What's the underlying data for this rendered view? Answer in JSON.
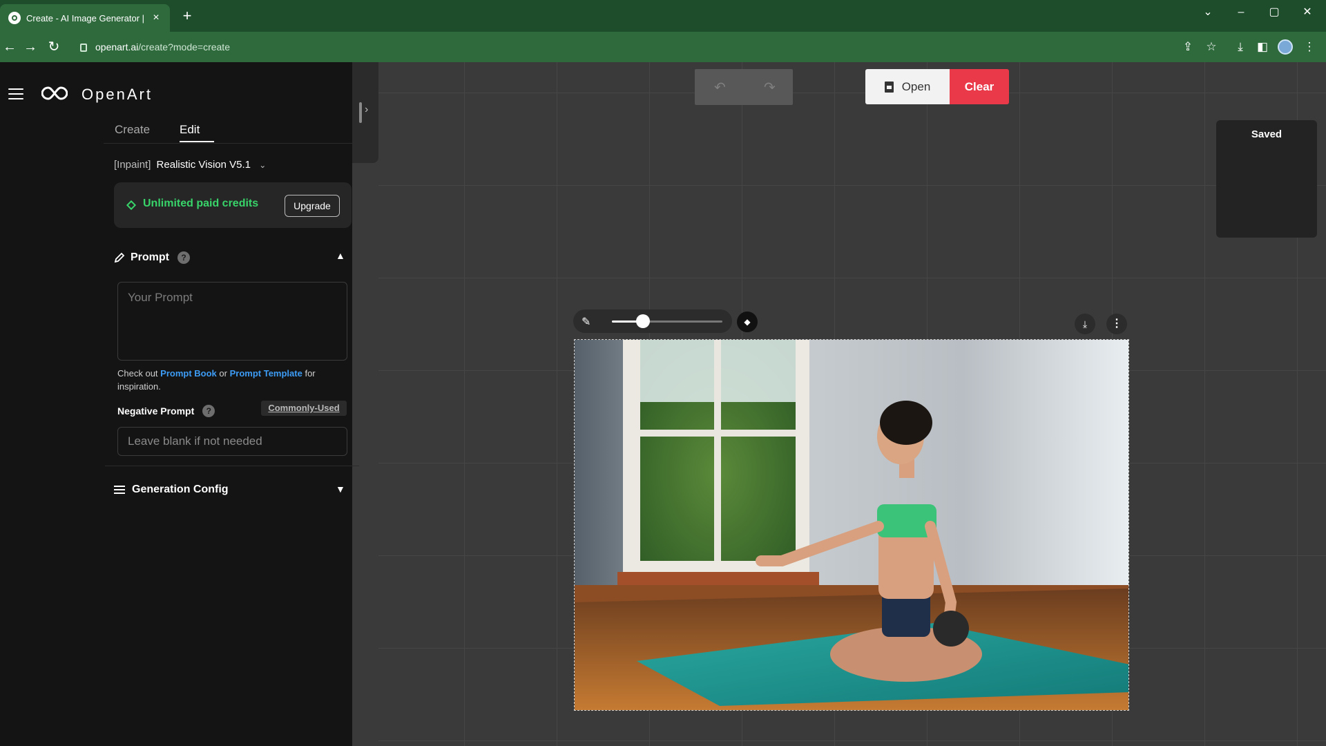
{
  "browser": {
    "tab_title": "Create - AI Image Generator | Op",
    "url_host": "openart.ai",
    "url_path": "/create?mode=create"
  },
  "app": {
    "brand": "OpenArt",
    "tabs": [
      "Create",
      "Edit"
    ],
    "active_tab": "Edit",
    "model_prefix": "[Inpaint]",
    "model_name": "Realistic Vision V5.1",
    "credits_text": "Unlimited paid credits",
    "upgrade_label": "Upgrade",
    "prompt_label": "Prompt",
    "prompt_placeholder": "Your Prompt",
    "inspire_pre": "Check out",
    "inspire_link1": "Prompt Book",
    "inspire_mid": "or",
    "inspire_link2": "Prompt Template",
    "inspire_post": "for inspiration.",
    "negative_label": "Negative Prompt",
    "commonly_used_label": "Commonly-Used",
    "negative_placeholder": "Leave blank if not needed",
    "gen_config_label": "Generation Config"
  },
  "canvas": {
    "open_label": "Open",
    "clear_label": "Clear",
    "saved_label": "Saved",
    "brush_size_fraction": 0.28
  },
  "colors": {
    "accent_green": "#38d46a",
    "link_blue": "#3d9cf5",
    "clear_red": "#ea3a4a"
  },
  "icons": {
    "hamburger": "menu-icon",
    "help": "help-icon",
    "brush": "brush-icon",
    "download": "download-icon",
    "more": "more-vertical-icon"
  }
}
